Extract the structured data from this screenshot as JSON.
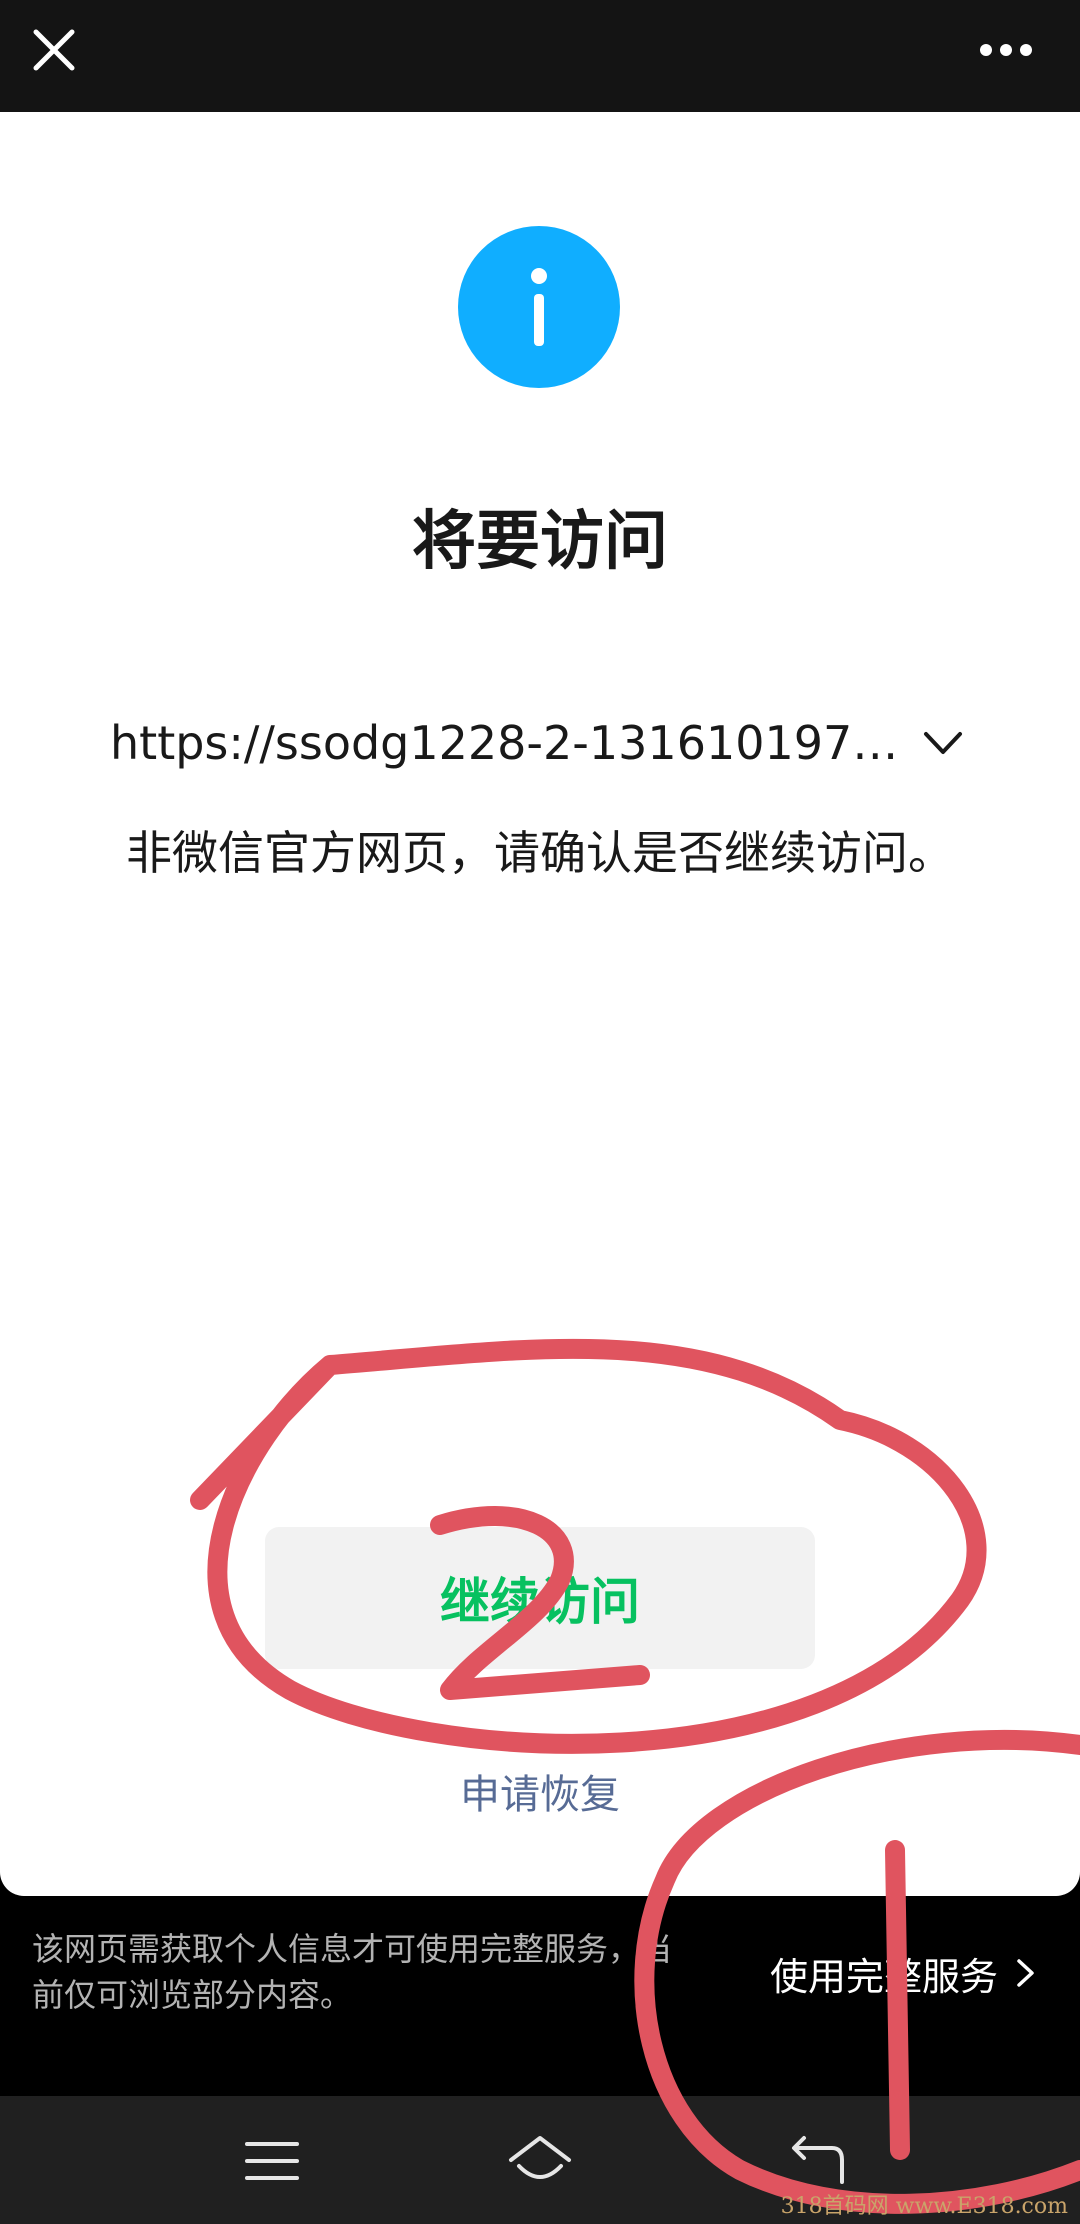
{
  "header": {
    "close_icon": "close-icon",
    "more_icon": "more-icon"
  },
  "dialog": {
    "icon": "info-icon",
    "icon_color": "#10aeff",
    "title": "将要访问",
    "url": "https://ssodg1228-2-1316101976…",
    "warning": "非微信官方网页，请确认是否继续访问。",
    "continue_label": "继续访问",
    "continue_color": "#07c160",
    "feedback_label": "申请恢复"
  },
  "banner": {
    "text": "该网页需获取个人信息才可使用完整服务，当前仅可浏览部分内容。",
    "action_label": "使用完整服务"
  },
  "system_nav": {
    "menu_icon": "menu-icon",
    "home_icon": "home-icon",
    "back_icon": "back-icon"
  },
  "annotations": {
    "circle_1_label": "1",
    "circle_2_label": "2",
    "color": "#e0545f"
  },
  "watermark": "318首码网 www.E318.com"
}
